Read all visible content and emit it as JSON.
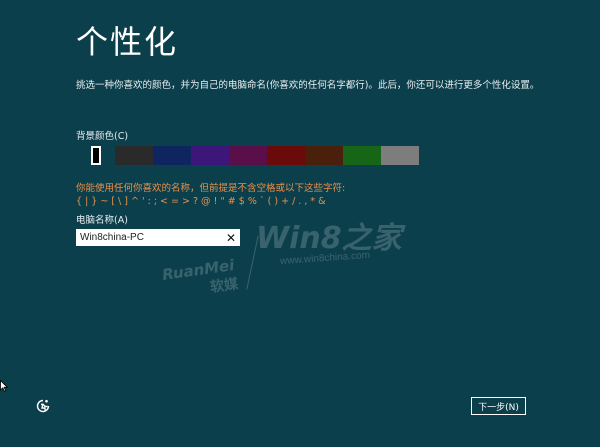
{
  "page": {
    "title": "个性化",
    "description": "挑选一种你喜欢的颜色，并为自己的电脑命名(你喜欢的任何名字都行)。此后，你还可以进行更多个性化设置。"
  },
  "background_color": {
    "label": "背景颜色(C)",
    "selected_index": 1,
    "swatches": [
      {
        "color": "#0c3f4c",
        "width": 15
      },
      {
        "color": "#000000",
        "width": 10
      },
      {
        "color": "#0c3f4c",
        "width": 14
      },
      {
        "color": "#2a2a2a",
        "width": 38
      },
      {
        "color": "#0e2560",
        "width": 38
      },
      {
        "color": "#3c1678",
        "width": 38
      },
      {
        "color": "#5b0f4a",
        "width": 38
      },
      {
        "color": "#6b0a0a",
        "width": 38
      },
      {
        "color": "#4a1f0c",
        "width": 38
      },
      {
        "color": "#176517",
        "width": 38
      },
      {
        "color": "#7d7d7d",
        "width": 38
      }
    ]
  },
  "warning": {
    "line1": "你能使用任何你喜欢的名称，但前提是不含空格或以下这些字符:",
    "line2": "{ | } ~ [ \\ ] ^ ' : ; < = > ? @ ! \" # $ % ` ( ) + / . , * &"
  },
  "computer_name": {
    "label": "电脑名称(A)",
    "value": "Win8china-PC",
    "clear_glyph": "✕"
  },
  "next_button": {
    "label": "下一步(N)"
  },
  "watermark": {
    "main": "Win8之家",
    "url": "www.win8china.com",
    "brand": "RuanMei",
    "brand_cn": "软媒"
  },
  "icons": {
    "ease_of_access": "ease-of-access-icon",
    "cursor": "mouse-cursor-icon"
  }
}
